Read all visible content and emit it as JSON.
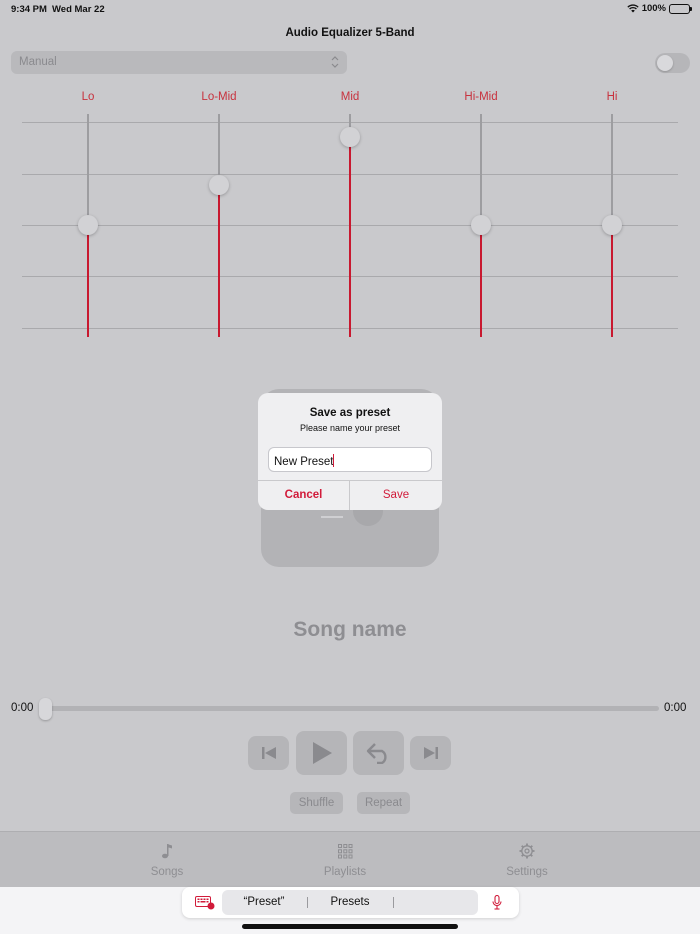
{
  "status_bar": {
    "time": "9:34 PM",
    "date": "Wed Mar 22",
    "battery": "100%"
  },
  "nav": {
    "title": "Audio Equalizer 5-Band"
  },
  "preset_select": {
    "value": "Manual"
  },
  "toggle": {
    "on": false
  },
  "eq": {
    "bands": [
      {
        "label": "Lo",
        "level": 0.5
      },
      {
        "label": "Lo-Mid",
        "level": 0.68
      },
      {
        "label": "Mid",
        "level": 0.9
      },
      {
        "label": "Hi-Mid",
        "level": 0.5
      },
      {
        "label": "Hi",
        "level": 0.5
      }
    ]
  },
  "player": {
    "song_name": "Song name",
    "elapsed": "0:00",
    "remaining": "0:00",
    "progress": 0,
    "shuffle_label": "Shuffle",
    "repeat_label": "Repeat"
  },
  "dialog": {
    "title": "Save as preset",
    "message": "Please name your preset",
    "input_value": "New Preset",
    "cancel_label": "Cancel",
    "save_label": "Save"
  },
  "tabs": [
    {
      "label": "Songs",
      "icon": "music-note-icon"
    },
    {
      "label": "Playlists",
      "icon": "grid-icon"
    },
    {
      "label": "Settings",
      "icon": "gear-icon"
    }
  ],
  "keyboard": {
    "suggestions": [
      "“Preset”",
      "Presets",
      ""
    ]
  },
  "colors": {
    "accent": "#c8182f",
    "label_red": "#c8323e"
  }
}
